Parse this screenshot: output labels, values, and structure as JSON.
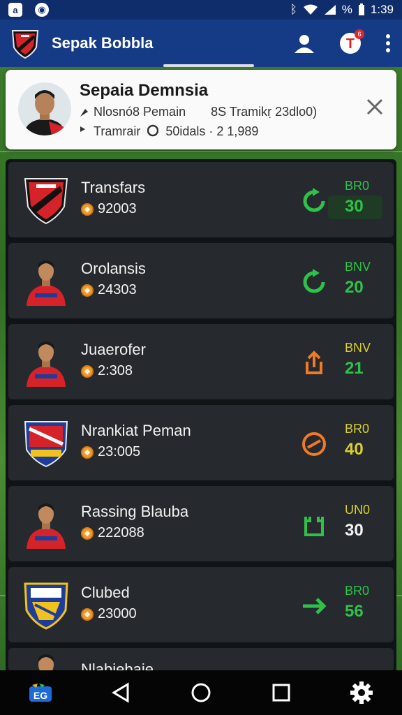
{
  "status_bar": {
    "left_icons": [
      "app-icon",
      "chat-icon"
    ],
    "app_icon_glyph": "a",
    "chat_icon_glyph": "◉",
    "right_icons": [
      "bluetooth-icon",
      "wifi-icon",
      "signal-icon"
    ],
    "bluetooth_glyph": "ᛒ",
    "battery_text": "%",
    "time": "1:39"
  },
  "app_bar": {
    "title": "Sepak Bobbla",
    "badge_count": "6",
    "notif_letter": "T"
  },
  "player_card": {
    "name": "Sepaia Demnsia",
    "line1_left": "Nlosnó8 Pemain",
    "line1_right": "8S Tramikṛ 23dlo0)",
    "line2_left": "Tramrair",
    "line2_right": "50idals · 2 1,989"
  },
  "rows": [
    {
      "title": "Transfars",
      "value": "92003",
      "stat_label": "BR0",
      "stat_value": "30",
      "status": "refresh-icon",
      "status_color": "#2ec24a",
      "label_color": "#2ec24a",
      "value_color": "#2ec24a",
      "highlight": true,
      "crest": "shield-red"
    },
    {
      "title": "Orolansis",
      "value": "24303",
      "stat_label": "BNV",
      "stat_value": "20",
      "status": "refresh-icon",
      "status_color": "#2ec24a",
      "label_color": "#2ec24a",
      "value_color": "#2ec24a",
      "highlight": false,
      "crest": "player-red"
    },
    {
      "title": "Juaerofer",
      "value": "2:308",
      "stat_label": "BNV",
      "stat_value": "21",
      "status": "upload-icon",
      "status_color": "#f07a25",
      "label_color": "#d9d02e",
      "value_color": "#2ec24a",
      "highlight": false,
      "crest": "player-red"
    },
    {
      "title": "Nrankiat Peman",
      "value": "23:005",
      "stat_label": "BR0",
      "stat_value": "40",
      "status": "no-entry-icon",
      "status_color": "#f07a25",
      "label_color": "#d9d02e",
      "value_color": "#d9d02e",
      "highlight": false,
      "crest": "shield-blue"
    },
    {
      "title": "Rassing Blauba",
      "value": "222088",
      "stat_label": "UN0",
      "stat_value": "30",
      "status": "bench-icon",
      "status_color": "#2ec24a",
      "label_color": "#d9d02e",
      "value_color": "#f2f2f2",
      "highlight": false,
      "crest": "player-red"
    },
    {
      "title": "Clubed",
      "value": "23000",
      "stat_label": "BR0",
      "stat_value": "56",
      "status": "arrow-right-icon",
      "status_color": "#2ec24a",
      "label_color": "#2ec24a",
      "value_color": "#2ec24a",
      "highlight": false,
      "crest": "shield-blue-yellow"
    }
  ],
  "partial_row_title": "Nlabiebaie",
  "nav_bar": {
    "items": [
      "app-logo-icon",
      "back-icon",
      "home-icon",
      "recents-icon",
      "settings-icon"
    ],
    "logo_text": "EG"
  },
  "colors": {
    "status_bar": "#0f2d6b",
    "app_bar": "#163b86",
    "row_bg": "#26292d"
  }
}
